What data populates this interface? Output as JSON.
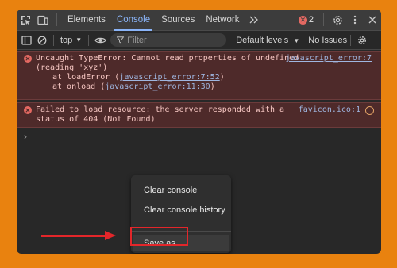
{
  "tabbar": {
    "tabs": [
      {
        "label": "Elements",
        "active": false
      },
      {
        "label": "Console",
        "active": true
      },
      {
        "label": "Sources",
        "active": false
      },
      {
        "label": "Network",
        "active": false
      }
    ],
    "more_tabs_icon": "chevrons-right-icon",
    "error_count": "2",
    "icons": [
      "inspect-icon",
      "device-toolbar-icon",
      "gear-icon",
      "more-vert-icon",
      "close-icon"
    ]
  },
  "toolbar": {
    "context": "top",
    "filter_placeholder": "Filter",
    "levels_label": "Default levels",
    "issues_label": "No Issues"
  },
  "messages": [
    {
      "type": "error",
      "text": "Uncaught TypeError: Cannot read properties of undefined",
      "text_cont": "(reading 'xyz')",
      "source": "javascript_error:7",
      "stack": [
        {
          "prefix": "at loadError (",
          "link": "javascript_error:7:52",
          "suffix": ")"
        },
        {
          "prefix": "at onload (",
          "link": "javascript_error:11:30",
          "suffix": ")"
        }
      ]
    },
    {
      "type": "error",
      "text": "Failed to load resource: the server responded with a",
      "text_cont": "status of 404 (Not Found)",
      "source": "favicon.ico:1"
    }
  ],
  "prompt_symbol": "›",
  "context_menu": {
    "items": [
      "Clear console",
      "Clear console history",
      "Save as..."
    ]
  },
  "colors": {
    "page_background": "#e9820f",
    "accent": "#8ab4f8",
    "error": "#e46962",
    "highlight": "#e3262a"
  }
}
